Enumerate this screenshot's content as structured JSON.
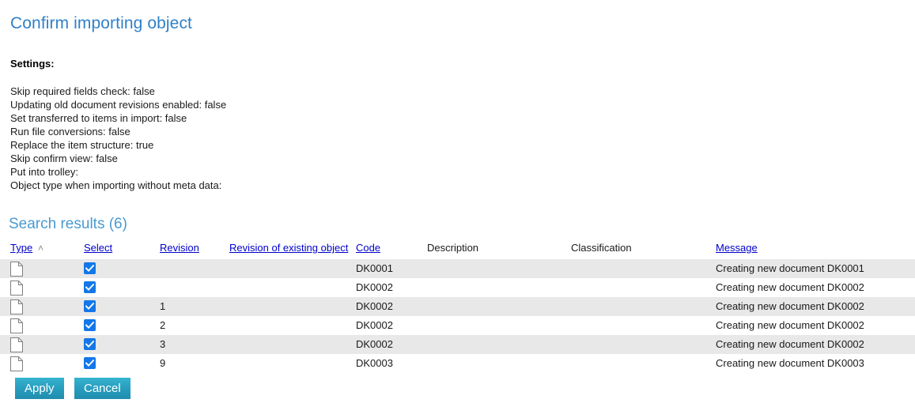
{
  "page": {
    "title": "Confirm importing object"
  },
  "settings": {
    "label": "Settings:",
    "lines": [
      "Skip required fields check: false",
      "Updating old document revisions enabled: false",
      "Set transferred to items in import: false",
      "Run file conversions: false",
      "Replace the item structure: true",
      "Skip confirm view: false",
      "Put into trolley:",
      "Object type when importing without meta data:"
    ]
  },
  "results": {
    "heading": "Search results (6)",
    "count": 6,
    "sort": {
      "column": "Type",
      "caret": "˄"
    },
    "columns": [
      {
        "label": "Type",
        "link": true
      },
      {
        "label": "Select",
        "link": true
      },
      {
        "label": "Revision",
        "link": true
      },
      {
        "label": "Revision of existing object",
        "link": true
      },
      {
        "label": "Code",
        "link": true
      },
      {
        "label": "Description",
        "link": false
      },
      {
        "label": "Classification",
        "link": false
      },
      {
        "label": "Message",
        "link": true
      }
    ],
    "rows": [
      {
        "type_icon": "document-icon",
        "selected": true,
        "revision": "",
        "revision_of_existing_object": "",
        "code": "DK0001",
        "description": "",
        "classification": "",
        "message": "Creating new document DK0001"
      },
      {
        "type_icon": "document-icon",
        "selected": true,
        "revision": "",
        "revision_of_existing_object": "",
        "code": "DK0002",
        "description": "",
        "classification": "",
        "message": "Creating new document DK0002"
      },
      {
        "type_icon": "document-icon",
        "selected": true,
        "revision": "1",
        "revision_of_existing_object": "",
        "code": "DK0002",
        "description": "",
        "classification": "",
        "message": "Creating new document DK0002"
      },
      {
        "type_icon": "document-icon",
        "selected": true,
        "revision": "2",
        "revision_of_existing_object": "",
        "code": "DK0002",
        "description": "",
        "classification": "",
        "message": "Creating new document DK0002"
      },
      {
        "type_icon": "document-icon",
        "selected": true,
        "revision": "3",
        "revision_of_existing_object": "",
        "code": "DK0002",
        "description": "",
        "classification": "",
        "message": "Creating new document DK0002"
      },
      {
        "type_icon": "document-icon",
        "selected": true,
        "revision": "9",
        "revision_of_existing_object": "",
        "code": "DK0003",
        "description": "",
        "classification": "",
        "message": "Creating new document DK0003"
      }
    ]
  },
  "actions": {
    "apply_label": "Apply",
    "cancel_label": "Cancel"
  },
  "colors": {
    "title_blue": "#3080c8",
    "heading_blue": "#4a9ad0",
    "link_blue": "#0000cc",
    "checkbox_blue": "#1377e8",
    "button_teal": "#2a9fc0",
    "row_stripe": "#e8e8e8"
  }
}
